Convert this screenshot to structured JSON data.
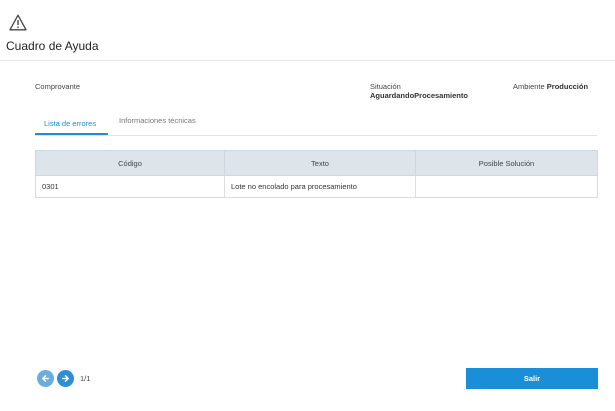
{
  "header": {
    "title": "Cuadro de Ayuda",
    "icon": "warning-icon"
  },
  "info": {
    "comprovante_label": "Comprovante",
    "situacion_label": "Situación",
    "situacion_value": "AguardandoProcesamiento",
    "ambiente_label": "Ambiente",
    "ambiente_value": "Producción"
  },
  "tabs": [
    {
      "label": "Lista de errores",
      "active": true
    },
    {
      "label": "Informaciones técnicas",
      "active": false
    }
  ],
  "table": {
    "columns": [
      "Código",
      "Texto",
      "Posible Solución"
    ],
    "rows": [
      [
        "0301",
        "Lote no encolado para procesamiento",
        ""
      ]
    ]
  },
  "pager": {
    "text": "1/1"
  },
  "footer": {
    "exit_label": "Salir"
  },
  "colors": {
    "accent": "#1a8fd8",
    "header_bg": "#dde4ea"
  }
}
